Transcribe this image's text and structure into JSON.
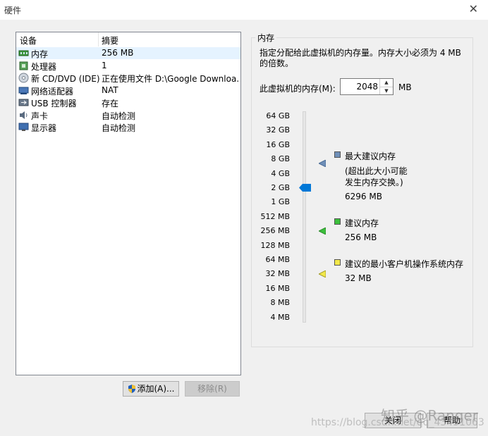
{
  "window": {
    "title": "硬件"
  },
  "devices": {
    "col_device": "设备",
    "col_summary": "摘要",
    "rows": [
      {
        "name": "内存",
        "summary": "256 MB",
        "icon": "memory-icon"
      },
      {
        "name": "处理器",
        "summary": "1",
        "icon": "cpu-icon"
      },
      {
        "name": "新 CD/DVD (IDE)",
        "summary": "正在使用文件 D:\\Google Downloa...",
        "icon": "cd-dvd-icon"
      },
      {
        "name": "网络适配器",
        "summary": "NAT",
        "icon": "network-icon"
      },
      {
        "name": "USB 控制器",
        "summary": "存在",
        "icon": "usb-icon"
      },
      {
        "name": "声卡",
        "summary": "自动检测",
        "icon": "speaker-icon"
      },
      {
        "name": "显示器",
        "summary": "自动检测",
        "icon": "monitor-icon"
      }
    ],
    "selected_index": 0
  },
  "buttons": {
    "add": "添加(A)...",
    "remove": "移除(R)",
    "close": "关闭",
    "help": "帮助"
  },
  "memory": {
    "group_title": "内存",
    "description": "指定分配给此虚拟机的内存量。内存大小必须为 4 MB 的倍数。",
    "field_label": "此虚拟机的内存(M):",
    "value": "2048",
    "unit": "MB",
    "scale_ticks": [
      "64 GB",
      "32 GB",
      "16 GB",
      "8 GB",
      "4 GB",
      "2 GB",
      "1 GB",
      "512 MB",
      "256 MB",
      "128 MB",
      "64 MB",
      "32 MB",
      "16 MB",
      "8 MB",
      "4 MB"
    ],
    "current_tick": "2 GB",
    "max_recommended": {
      "label": "最大建议内存",
      "note_line1": "(超出此大小可能",
      "note_line2": "发生内存交换。)",
      "value": "6296 MB",
      "color": "#6f8fb8",
      "tick": "8 GB"
    },
    "recommended": {
      "label": "建议内存",
      "value": "256 MB",
      "color": "#3cbf3c",
      "tick": "256 MB"
    },
    "min_guest": {
      "label": "建议的最小客户机操作系统内存",
      "value": "32 MB",
      "color": "#f2e84a",
      "tick": "32 MB"
    }
  },
  "watermark": {
    "brand": "知乎 @Ranger",
    "url": "https://blog.csdn.net/qq_43451063"
  },
  "colors": {
    "accent": "#0078d7",
    "selection": "#e5f3ff"
  }
}
